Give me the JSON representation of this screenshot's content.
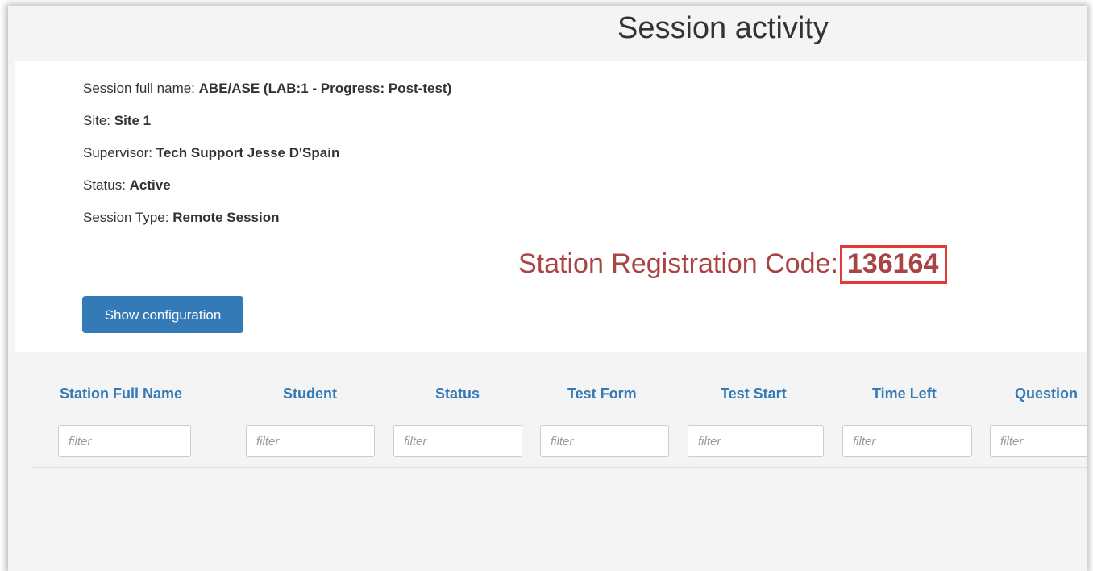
{
  "page": {
    "title": "Session activity"
  },
  "session": {
    "full_name_label": "Session full name:",
    "full_name_value": "ABE/ASE (LAB:1 - Progress: Post-test)",
    "site_label": "Site:",
    "site_value": "Site 1",
    "supervisor_label": "Supervisor:",
    "supervisor_value": "Tech Support Jesse D'Spain",
    "status_label": "Status:",
    "status_value": "Active",
    "type_label": "Session Type:",
    "type_value": "Remote Session",
    "registration_label": "Station Registration Code:",
    "registration_code": "136164"
  },
  "actions": {
    "show_configuration": "Show configuration"
  },
  "table": {
    "columns": [
      "Station Full Name",
      "Student",
      "Status",
      "Test Form",
      "Test Start",
      "Time Left",
      "Question"
    ],
    "filter_placeholder": "filter"
  },
  "colors": {
    "accent": "#337ab7",
    "registration_text": "#a94442",
    "highlight_box": "#e53935"
  }
}
